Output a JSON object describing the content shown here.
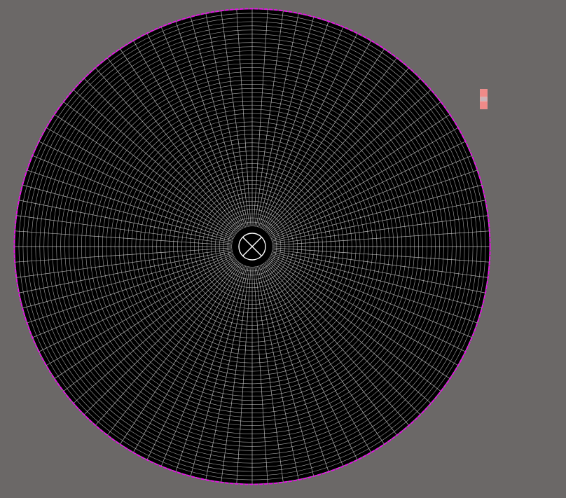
{
  "viewport": {
    "background_color": "#6b6867",
    "mesh": {
      "shape": "disk",
      "fill_color": "#000000",
      "grid_color": "#d9d9d9",
      "outline_color": "#e514e5",
      "radial_divisions": 96,
      "ring_divisions": 52,
      "hole_marker": "circled-x"
    },
    "gizmo": {
      "icon": "view-handle-icon",
      "colors": [
        "#f08a88",
        "#c9b3b8",
        "#f08a88"
      ]
    }
  }
}
